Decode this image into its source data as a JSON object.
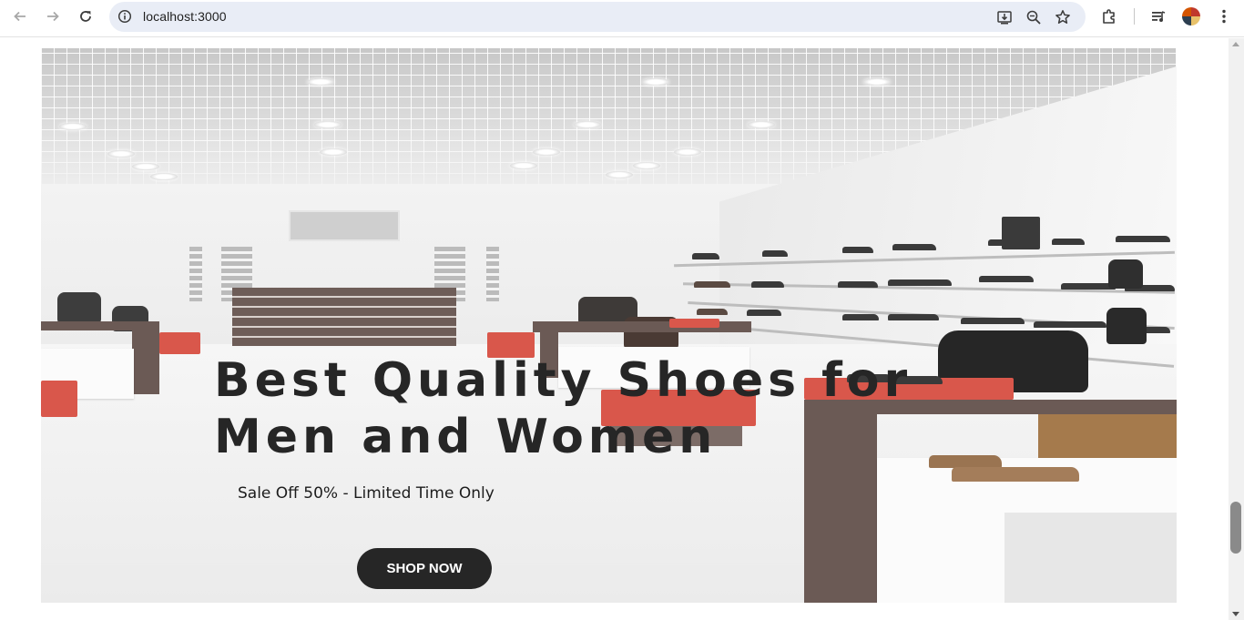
{
  "browser": {
    "url": "localhost:3000",
    "back_icon": "arrow-left-icon",
    "forward_icon": "arrow-right-icon",
    "reload_icon": "reload-icon",
    "site_info_icon": "info-icon",
    "install_icon": "install-app-icon",
    "zoom_icon": "zoom-icon",
    "bookmark_icon": "star-icon",
    "extensions_icon": "puzzle-icon",
    "media_icon": "media-controls-icon",
    "menu_icon": "kebab-menu-icon"
  },
  "hero": {
    "title_line1": "Best Quality Shoes for",
    "title_line2": "Men and Women",
    "subtitle": "Sale Off 50% - Limited Time Only",
    "cta_label": "SHOP NOW",
    "colors": {
      "title": "#262626",
      "button_bg": "#262626",
      "button_text": "#ffffff",
      "accent_red": "#d9574b"
    }
  }
}
